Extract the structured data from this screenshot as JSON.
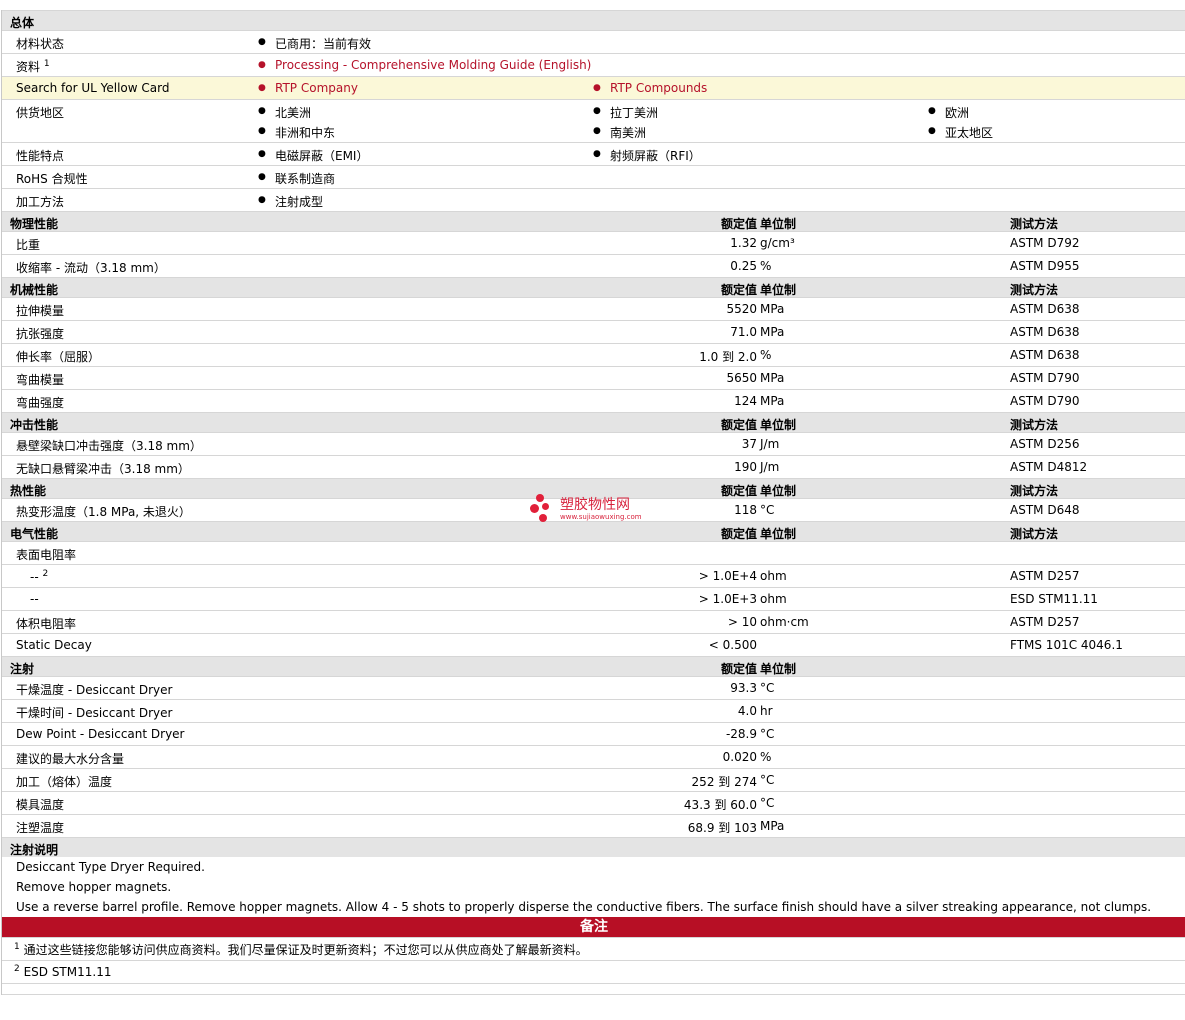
{
  "general": {
    "header": "总体",
    "material_status": {
      "label": "材料状态",
      "value": "已商用：当前有效"
    },
    "literature": {
      "label": "资料",
      "sup": "1",
      "link": "Processing - Comprehensive Molding Guide (English)"
    },
    "ul_card": {
      "label": "Search for UL Yellow Card",
      "link1": "RTP Company",
      "link2": "RTP Compounds"
    },
    "availability": {
      "label": "供货地区",
      "regions": [
        "北美洲",
        "拉丁美洲",
        "欧洲",
        "非洲和中东",
        "南美洲",
        "亚太地区"
      ]
    },
    "features": {
      "label": "性能特点",
      "items": [
        "电磁屏蔽（EMI）",
        "射频屏蔽（RFI）"
      ]
    },
    "rohs": {
      "label": "RoHS 合规性",
      "value": "联系制造商"
    },
    "processing_method": {
      "label": "加工方法",
      "value": "注射成型"
    }
  },
  "col_headers": {
    "value": "额定值",
    "unit": "单位制",
    "method": "测试方法"
  },
  "physical": {
    "title": "物理性能",
    "rows": [
      {
        "label": "比重",
        "value": "1.32",
        "unit": "g/cm³",
        "method": "ASTM D792"
      },
      {
        "label": "收缩率  - 流动（3.18 mm）",
        "value": "0.25",
        "unit": "%",
        "method": "ASTM D955"
      }
    ]
  },
  "mechanical": {
    "title": "机械性能",
    "rows": [
      {
        "label": "拉伸模量",
        "value": "5520",
        "unit": "MPa",
        "method": "ASTM D638"
      },
      {
        "label": "抗张强度",
        "value": "71.0",
        "unit": "MPa",
        "method": "ASTM D638"
      },
      {
        "label": "伸长率（屈服）",
        "value": "1.0 到  2.0",
        "unit": "%",
        "method": "ASTM D638"
      },
      {
        "label": "弯曲模量",
        "value": "5650",
        "unit": "MPa",
        "method": "ASTM D790"
      },
      {
        "label": "弯曲强度",
        "value": "124",
        "unit": "MPa",
        "method": "ASTM D790"
      }
    ]
  },
  "impact": {
    "title": "冲击性能",
    "rows": [
      {
        "label": "悬壁梁缺口冲击强度（3.18 mm）",
        "value": "37",
        "unit": "J/m",
        "method": "ASTM D256"
      },
      {
        "label": "无缺口悬臂梁冲击（3.18 mm）",
        "value": "190",
        "unit": "J/m",
        "method": "ASTM D4812"
      }
    ]
  },
  "thermal": {
    "title": "热性能",
    "rows": [
      {
        "label": "热变形温度（1.8 MPa, 未退火）",
        "value": "118",
        "unit": "°C",
        "method": "ASTM D648"
      }
    ]
  },
  "electrical": {
    "title": "电气性能",
    "surface_label": "表面电阻率",
    "sub1": {
      "label": "--",
      "sup": "2",
      "value": "> 1.0E+4",
      "unit": "ohm",
      "method": "ASTM D257"
    },
    "sub2": {
      "label": "--",
      "value": "> 1.0E+3",
      "unit": "ohm",
      "method": "ESD STM11.11"
    },
    "rows": [
      {
        "label": "体积电阻率",
        "value": "> 10",
        "unit": "ohm·cm",
        "method": "ASTM D257"
      },
      {
        "label": "Static Decay",
        "value": "< 0.500",
        "unit": "",
        "method": "FTMS 101C 4046.1"
      }
    ]
  },
  "injection": {
    "title": "注射",
    "rows": [
      {
        "label": "干燥温度  - Desiccant Dryer",
        "value": "93.3",
        "unit": "°C"
      },
      {
        "label": "干燥时间  - Desiccant Dryer",
        "value": "4.0",
        "unit": "hr"
      },
      {
        "label": "Dew Point - Desiccant Dryer",
        "value": "-28.9",
        "unit": "°C"
      },
      {
        "label": "建议的最大水分含量",
        "value": "0.020",
        "unit": "%"
      },
      {
        "label": "加工（熔体）温度",
        "value": "252 到  274",
        "unit": "°C"
      },
      {
        "label": "模具温度",
        "value": "43.3 到  60.0",
        "unit": "°C"
      },
      {
        "label": "注塑温度",
        "value": "68.9 到  103",
        "unit": "MPa"
      }
    ]
  },
  "injection_notes": {
    "title": "注射说明",
    "lines": [
      "Desiccant Type Dryer Required.",
      "Remove hopper magnets.",
      "Use a reverse barrel profile. Remove hopper magnets. Allow 4 - 5 shots to properly disperse the conductive fibers. The surface finish should have a silver streaking appearance, not clumps."
    ]
  },
  "notes": {
    "title": "备注",
    "items": [
      {
        "num": "1",
        "text": "通过这些链接您能够访问供应商资料。我们尽量保证及时更新资料；不过您可以从供应商处了解最新资料。"
      },
      {
        "num": "2",
        "text": "ESD STM11.11"
      }
    ]
  },
  "watermark": {
    "line1": "塑胶物性网",
    "line2": "www.sujiaowuxing.com"
  }
}
